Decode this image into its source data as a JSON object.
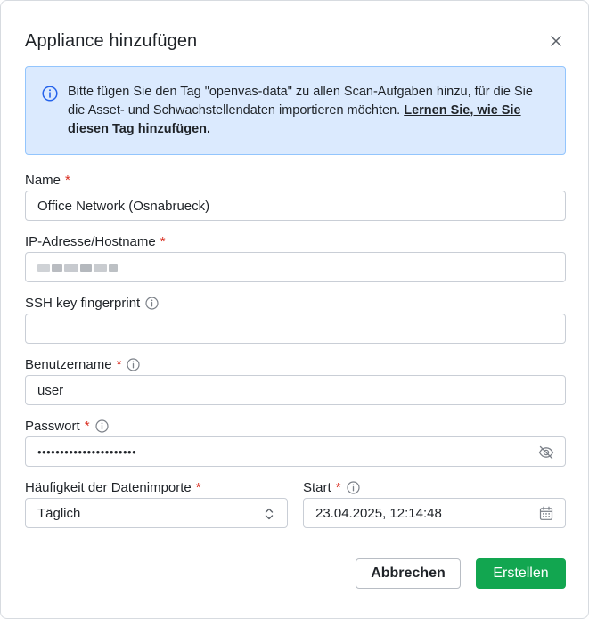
{
  "dialog": {
    "title": "Appliance hinzufügen",
    "close_icon": "close-icon"
  },
  "info": {
    "icon": "info-icon",
    "text": "Bitte fügen Sie den Tag \"openvas-data\" zu allen Scan-Aufgaben hinzu, für die Sie die Asset- und Schwachstellendaten importieren möchten. ",
    "link": "Lernen Sie, wie Sie diesen Tag hinzufügen."
  },
  "required_marker": "*",
  "fields": {
    "name": {
      "label": "Name",
      "value": "Office Network (Osnabrueck)"
    },
    "ip": {
      "label": "IP-Adresse/Hostname",
      "value_note": "blurred"
    },
    "ssh": {
      "label": "SSH key fingerprint",
      "value": ""
    },
    "user": {
      "label": "Benutzername",
      "value": "user"
    },
    "password": {
      "label": "Passwort",
      "masked": "••••••••••••••••••••••",
      "toggle_icon": "eye-off-icon"
    },
    "frequency": {
      "label": "Häufigkeit der Datenimporte",
      "value": "Täglich",
      "options": [
        "Täglich"
      ]
    },
    "start": {
      "label": "Start",
      "value": "23.04.2025, 12:14:48",
      "icon": "calendar-icon"
    }
  },
  "buttons": {
    "cancel": "Abbrechen",
    "create": "Erstellen"
  },
  "colors": {
    "primary": "#12a650",
    "banner_bg": "#dbeafe",
    "banner_border": "#93c5fd",
    "required": "#d92d20"
  }
}
